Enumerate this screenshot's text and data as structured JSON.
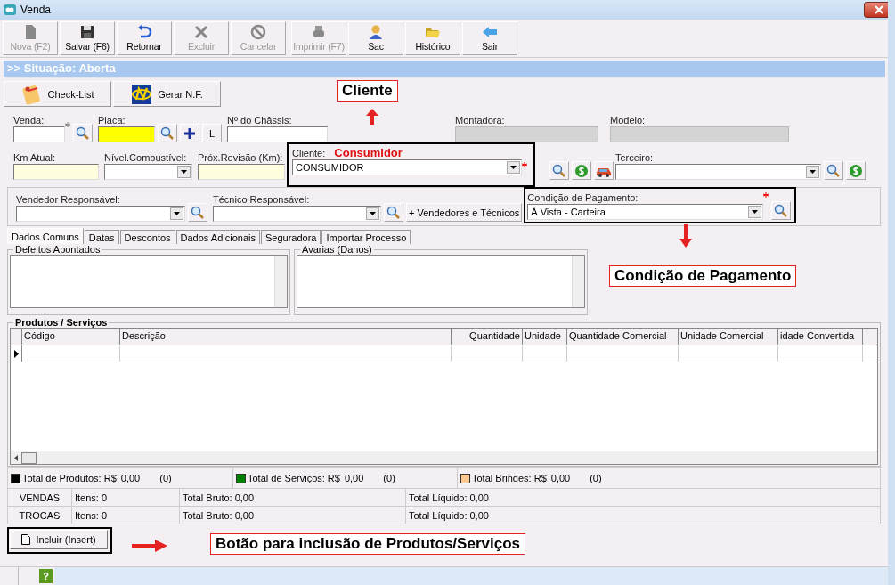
{
  "window": {
    "title": "Venda"
  },
  "toolbar": [
    {
      "label": "Nova (F2)",
      "disabled": true
    },
    {
      "label": "Salvar (F6)",
      "disabled": false
    },
    {
      "label": "Retornar",
      "disabled": false
    },
    {
      "label": "Excluir",
      "disabled": true
    },
    {
      "label": "Cancelar",
      "disabled": true
    },
    {
      "label": "Imprimir (F7)",
      "disabled": true
    },
    {
      "label": "Sac",
      "disabled": false
    },
    {
      "label": "Histórico",
      "disabled": false
    },
    {
      "label": "Sair",
      "disabled": false
    }
  ],
  "situation": ">> Situação: Aberta",
  "actions": [
    "Check-List",
    "Gerar N.F."
  ],
  "fields": {
    "venda": {
      "label": "Venda:",
      "required": true
    },
    "placa": {
      "label": "Placa:",
      "focused": true
    },
    "l_button": "L",
    "chassis": {
      "label": "Nº do Châssis:"
    },
    "montadora": {
      "label": "Montadora:",
      "disabled": true
    },
    "modelo": {
      "label": "Modelo:",
      "disabled": true
    },
    "km_atual": {
      "label": "Km Atual:",
      "highlighted": true
    },
    "nivel": {
      "label": "Nível.Combustível:"
    },
    "revisao": {
      "label": "Próx.Revisão (Km):",
      "highlighted": true
    },
    "cliente": {
      "label": "Cliente:",
      "value": "CONSUMIDOR",
      "required": true
    },
    "terceiro": {
      "label": "Terceiro:"
    },
    "vendedor": {
      "label": "Vendedor Responsável:"
    },
    "tecnico": {
      "label": "Técnico Responsável:"
    },
    "vendedores_button": "+ Vendedores e Técnicos",
    "condicao": {
      "label": "Condição de Pagamento:",
      "value": "À Vista - Carteira",
      "required": true
    }
  },
  "tabs": [
    {
      "label": "Dados Comuns",
      "selected": true
    },
    {
      "label": "Datas",
      "selected": false
    },
    {
      "label": "Descontos",
      "selected": false
    },
    {
      "label": "Dados Adicionais",
      "selected": false
    },
    {
      "label": "Seguradora",
      "selected": false
    },
    {
      "label": "Importar Processo",
      "selected": false
    }
  ],
  "defeitos": {
    "title": "Defeitos Apontados"
  },
  "avarias": {
    "title": "Avarias (Danos)"
  },
  "products": {
    "title": "Produtos / Serviços",
    "columns": [
      {
        "label": "Código"
      },
      {
        "label": "Descrição"
      },
      {
        "label": "Quantidade",
        "right_aligned": true
      },
      {
        "label": "Unidade"
      },
      {
        "label": "Quantidade Comercial"
      },
      {
        "label": "Unidade Comercial"
      },
      {
        "label": "idade Convertida"
      }
    ]
  },
  "totals": [
    {
      "label": "Total de Produtos: R$",
      "value": "0,00",
      "count": "(0)",
      "color": "#000000"
    },
    {
      "label": "Total de Serviços: R$",
      "value": "0,00",
      "count": "(0)",
      "color": "#008000"
    },
    {
      "label": "Total Brindes: R$",
      "value": "0,00",
      "count": "(0)",
      "color": "#ffc890"
    }
  ],
  "summary": [
    {
      "name": "VENDAS",
      "items": "Itens: 0",
      "bruto": "Total Bruto: 0,00",
      "liquido": "Total Líquido: 0,00"
    },
    {
      "name": "TROCAS",
      "items": "Itens: 0",
      "bruto": "Total Bruto: 0,00",
      "liquido": "Total Líquido: 0,00"
    }
  ],
  "include_button": "Incluir (Insert)",
  "annotations": {
    "cliente": "Cliente",
    "consumidor": "Consumidor",
    "condicao": "Condição de Pagamento",
    "botao": "Botão para inclusão de Produtos/Serviços"
  },
  "status_bar": {
    "help": "?"
  }
}
